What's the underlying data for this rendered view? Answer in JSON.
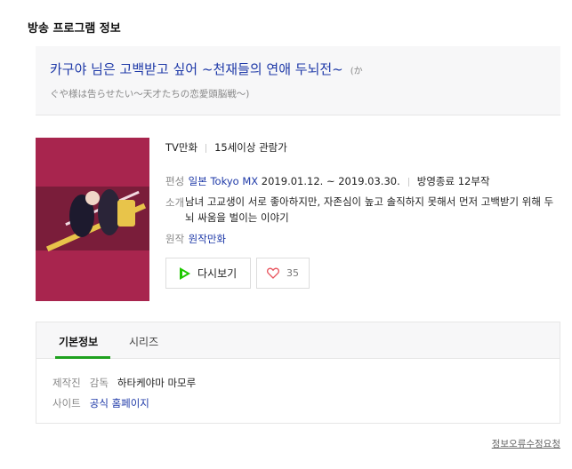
{
  "section_title": "방송 프로그램 정보",
  "program": {
    "title": "카구야 님은 고백받고 싶어 ~천재들의 연애 두뇌전~",
    "title_paren_start": "(か",
    "title_original_rest": "ぐや様は告らせたい～天才たちの恋愛頭脳戦～)"
  },
  "meta": {
    "genre": "TV만화",
    "rating": "15세이상 관람가"
  },
  "info": {
    "broadcast_label": "편성",
    "broadcast_country": "일본",
    "broadcast_channel": "Tokyo MX",
    "broadcast_period": "2019.01.12. ~ 2019.03.30.",
    "broadcast_status": "방영종료 12부작",
    "intro_label": "소개",
    "intro_text": "남녀 고교생이 서로 좋아하지만, 자존심이 높고 솔직하지 못해서 먼저 고백받기 위해 두뇌 싸움을 벌이는 이야기",
    "source_label": "원작",
    "source_value": "원작만화"
  },
  "actions": {
    "watch_label": "다시보기",
    "like_count": "35"
  },
  "tabs": [
    {
      "label": "기본정보",
      "active": true
    },
    {
      "label": "시리즈",
      "active": false
    }
  ],
  "details": {
    "production_label": "제작진",
    "director_label": "감독",
    "director_name": "하타케야마 마모루",
    "site_label": "사이트",
    "site_link": "공식 홈페이지"
  },
  "report_link": "정보오류수정요청",
  "colors": {
    "link_blue": "#1f3aa8",
    "tab_active_green": "#1ea11e",
    "poster_bg": "#a8254e",
    "play_icon_green": "#1ec800",
    "heart_red": "#e8515b"
  }
}
